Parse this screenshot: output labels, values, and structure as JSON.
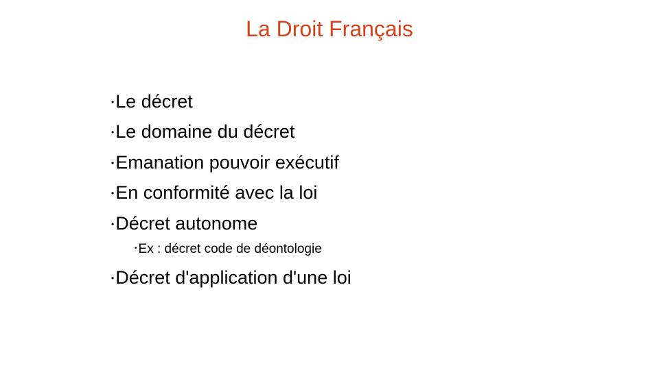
{
  "slide": {
    "title": "La Droit Français",
    "title_color": "#d7431a",
    "bullet_glyph": "•",
    "items": [
      {
        "text": "Le décret",
        "level": 1
      },
      {
        "text": "Le domaine du décret",
        "level": 1
      },
      {
        "text": "Emanation pouvoir exécutif",
        "level": 1
      },
      {
        "text": "En conformité avec la loi",
        "level": 1
      },
      {
        "text": "Décret autonome",
        "level": 1
      },
      {
        "text": "Ex : décret code de déontologie",
        "level": 2
      },
      {
        "text": "Décret d'application d'une loi",
        "level": 1
      }
    ]
  }
}
